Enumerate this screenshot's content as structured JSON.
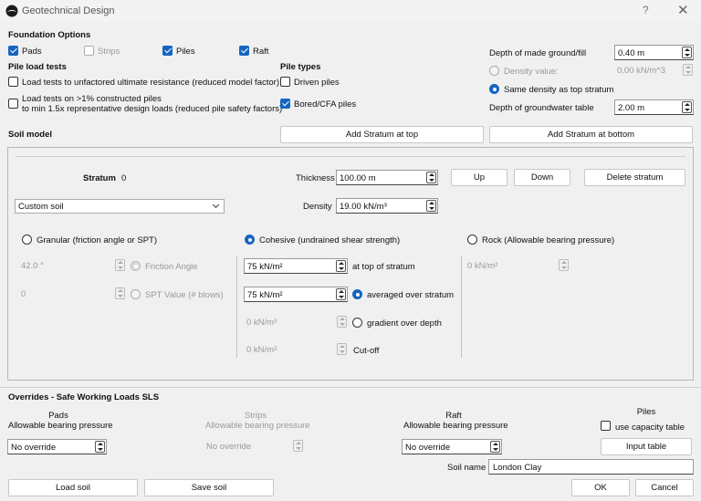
{
  "window": {
    "title": "Geotechnical Design",
    "help": "?",
    "close": "✕"
  },
  "foundation": {
    "heading": "Foundation Options",
    "options": [
      {
        "label": "Pads",
        "checked": true,
        "enabled": true
      },
      {
        "label": "Strips",
        "checked": false,
        "enabled": false
      },
      {
        "label": "Piles",
        "checked": true,
        "enabled": true
      },
      {
        "label": "Raft",
        "checked": true,
        "enabled": true
      }
    ]
  },
  "pile_load_tests": {
    "heading": "Pile load tests",
    "opt1": "Load tests to unfactored ultimate resistance (reduced model factor)",
    "opt2_line1": "Load tests on >1% constructed piles",
    "opt2_line2": "to min 1.5x representative design loads (reduced pile safety factors)"
  },
  "pile_types": {
    "heading": "Pile types",
    "driven": "Driven piles",
    "bored": "Bored/CFA piles"
  },
  "ground": {
    "made_ground_label": "Depth of made ground/fill",
    "made_ground_value": "0.40 m",
    "density_value_label": "Density value:",
    "density_value": "0.00 kN/m^3",
    "same_density_label": "Same density as top stratum",
    "groundwater_label": "Depth of groundwater table",
    "groundwater_value": "2.00 m"
  },
  "soil_model": {
    "heading": "Soil model",
    "add_top": "Add Stratum at top",
    "add_bottom": "Add Stratum at bottom"
  },
  "stratum": {
    "label": "Stratum",
    "index": "0",
    "thickness_label": "Thickness",
    "thickness_value": "100.00 m",
    "up": "Up",
    "down": "Down",
    "delete": "Delete stratum",
    "soil_type": "Custom soil",
    "density_label": "Density",
    "density_value": "19.00 kN/m³"
  },
  "granular": {
    "label": "Granular (friction angle or SPT)",
    "friction_value": "42.0 °",
    "friction_label": "Friction Angle",
    "spt_value": "0",
    "spt_label": "SPT Value (# blows)"
  },
  "cohesive": {
    "label": "Cohesive (undrained shear strength)",
    "top_value": "75 kN/m²",
    "top_label": "at top of stratum",
    "avg_value": "75 kN/m²",
    "avg_label": "averaged over stratum",
    "grad_value": "0 kN/m³",
    "grad_label": "gradient over depth",
    "cutoff_value": "0 kN/m²",
    "cutoff_label": "Cut-off"
  },
  "rock": {
    "label": "Rock (Allowable bearing pressure)",
    "value": "0 kN/m²"
  },
  "overrides": {
    "heading": "Overrides - Safe Working Loads SLS",
    "pads_title": "Pads",
    "pads_sub": "Allowable bearing pressure",
    "pads_value": "No override",
    "strips_title": "Strips",
    "strips_sub": "Allowable bearing pressure",
    "strips_value": "No override",
    "raft_title": "Raft",
    "raft_sub": "Allowable bearing pressure",
    "raft_value": "No override",
    "piles_title": "Piles",
    "use_capacity": "use capacity table",
    "input_table": "Input table"
  },
  "footer": {
    "soil_name_label": "Soil name",
    "soil_name_value": "London Clay",
    "load_soil": "Load soil",
    "save_soil": "Save soil",
    "ok": "OK",
    "cancel": "Cancel"
  }
}
